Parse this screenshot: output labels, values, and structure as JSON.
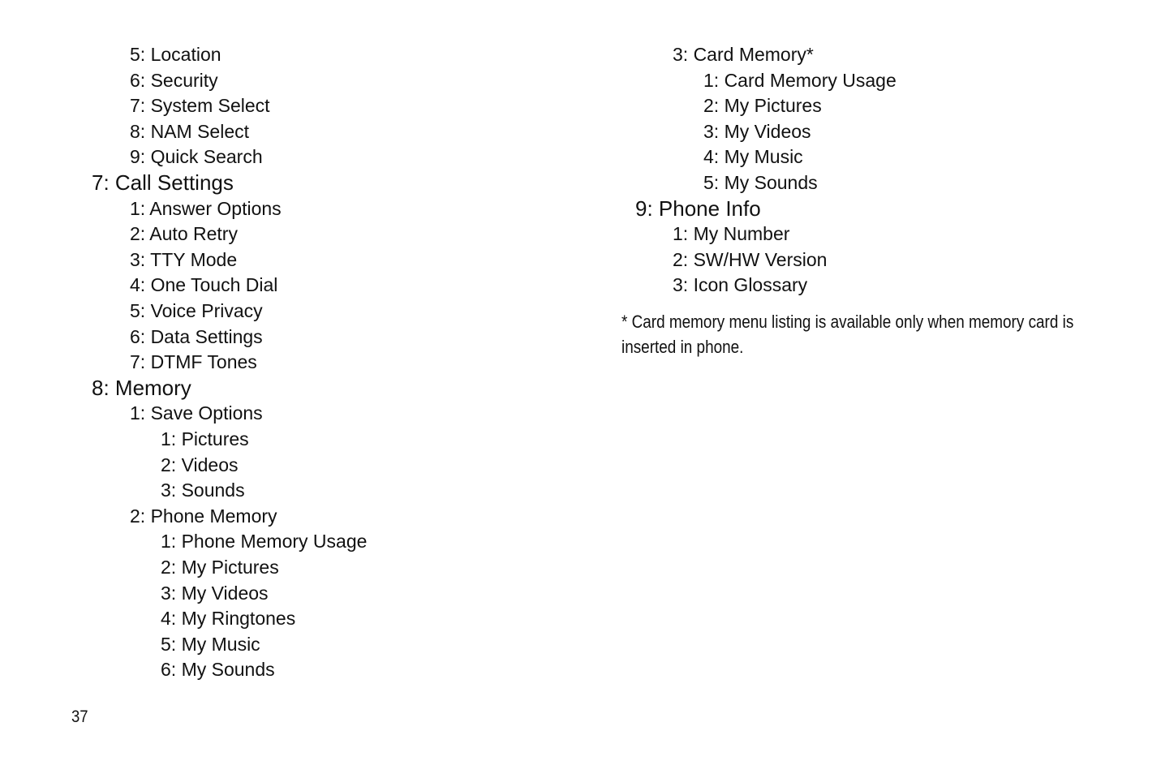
{
  "page_number": "37",
  "left_column": [
    {
      "level": 2,
      "text": "5: Location"
    },
    {
      "level": 2,
      "text": "6: Security"
    },
    {
      "level": 2,
      "text": "7: System Select"
    },
    {
      "level": 2,
      "text": "8: NAM Select"
    },
    {
      "level": 2,
      "text": "9: Quick Search"
    },
    {
      "level": 1,
      "text": "7: Call Settings"
    },
    {
      "level": 2,
      "text": "1: Answer Options"
    },
    {
      "level": 2,
      "text": "2: Auto Retry"
    },
    {
      "level": 2,
      "text": "3: TTY Mode"
    },
    {
      "level": 2,
      "text": "4: One Touch Dial"
    },
    {
      "level": 2,
      "text": "5: Voice Privacy"
    },
    {
      "level": 2,
      "text": "6: Data Settings"
    },
    {
      "level": 2,
      "text": "7: DTMF Tones"
    },
    {
      "level": 1,
      "text": "8: Memory"
    },
    {
      "level": 2,
      "text": "1: Save Options"
    },
    {
      "level": 3,
      "text": "1: Pictures"
    },
    {
      "level": 3,
      "text": "2: Videos"
    },
    {
      "level": 3,
      "text": "3: Sounds"
    },
    {
      "level": 2,
      "text": "2: Phone Memory"
    },
    {
      "level": 3,
      "text": "1: Phone Memory Usage"
    },
    {
      "level": 3,
      "text": "2: My Pictures"
    },
    {
      "level": 3,
      "text": "3: My Videos"
    },
    {
      "level": 3,
      "text": "4: My Ringtones"
    },
    {
      "level": 3,
      "text": "5: My Music"
    },
    {
      "level": 3,
      "text": "6: My Sounds"
    }
  ],
  "right_column": [
    {
      "level": 2,
      "text": "3: Card Memory*"
    },
    {
      "level": 3,
      "text": "1: Card Memory Usage"
    },
    {
      "level": 3,
      "text": "2: My Pictures"
    },
    {
      "level": 3,
      "text": "3: My Videos"
    },
    {
      "level": 3,
      "text": "4: My Music"
    },
    {
      "level": 3,
      "text": "5: My Sounds"
    },
    {
      "level": 1,
      "text": "9: Phone Info"
    },
    {
      "level": 2,
      "text": "1: My Number"
    },
    {
      "level": 2,
      "text": "2: SW/HW Version"
    },
    {
      "level": 2,
      "text": "3: Icon Glossary"
    }
  ],
  "footnote": "* Card memory menu listing is available only when memory card is inserted in phone."
}
